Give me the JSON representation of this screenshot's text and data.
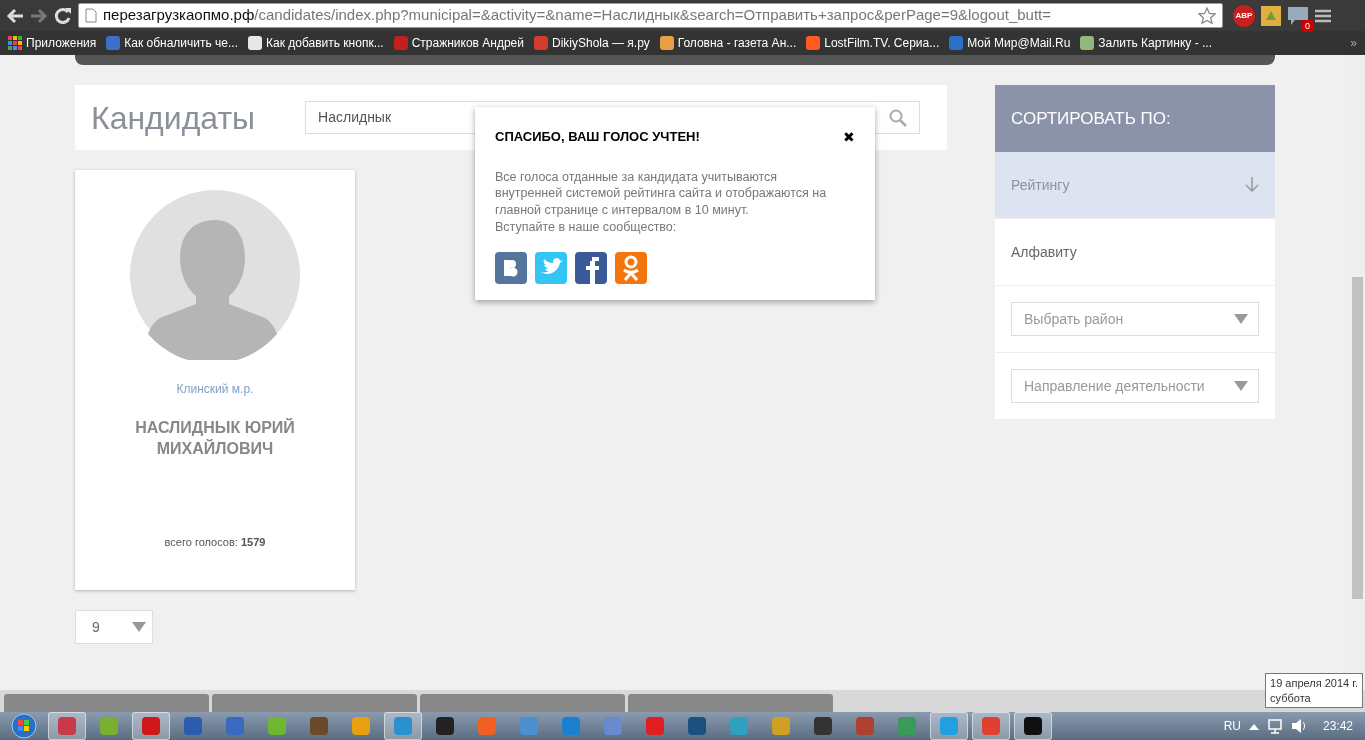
{
  "browser": {
    "url_host": "перезагрузкаопмо.рф",
    "url_rest": "/candidates/index.php?municipal=&activity=&name=Наслиднык&search=Отправить+запрос&perPage=9&logout_butt=",
    "abp": "ABP",
    "notify_count": "0",
    "apps_label": "Приложения",
    "bookmarks": [
      {
        "label": "Как обналичить че...",
        "color": "#3b6fc9"
      },
      {
        "label": "Как добавить кнопк...",
        "color": "#e8e8e8"
      },
      {
        "label": "Стражников Андрей",
        "color": "#c0201f"
      },
      {
        "label": "DikiyShola — я.ру",
        "color": "#d33b2c"
      },
      {
        "label": "Головна - газета Ан...",
        "color": "#e8a040"
      },
      {
        "label": "LostFilm.TV. Сериа...",
        "color": "#ff5a1f"
      },
      {
        "label": "Мой Мир@Mail.Ru",
        "color": "#2a6fc9"
      },
      {
        "label": "Залить Картинку - ...",
        "color": "#8fb87a"
      }
    ],
    "more": "»"
  },
  "page": {
    "title": "Кандидаты",
    "search": {
      "value": "Наслиднык"
    },
    "candidate": {
      "district": "Клинский м.р.",
      "name": "НАСЛИДНЫК ЮРИЙ МИХАЙЛОВИЧ",
      "votes_label": "всего голосов:",
      "votes": "1579"
    },
    "per_page": "9",
    "sort": {
      "title": "СОРТИРОВАТЬ ПО:",
      "options": [
        {
          "label": "Рейтингу",
          "selected": true
        },
        {
          "label": "Алфавиту",
          "selected": false
        }
      ],
      "dropdowns": [
        {
          "placeholder": "Выбрать район"
        },
        {
          "placeholder": "Направление деятельности"
        }
      ]
    }
  },
  "modal": {
    "title": "СПАСИБО, ВАШ ГОЛОС УЧТЕН!",
    "close": "✖",
    "text": "Все голоса отданные за кандидата учитываются внутренней системой рейтинга сайта и отображаются на главной странице с интервалом в 10 минут.",
    "invite": "Вступайте в наше сообщество:",
    "social": [
      {
        "kind": "vk"
      },
      {
        "kind": "twitter"
      },
      {
        "kind": "facebook"
      },
      {
        "kind": "ok"
      }
    ]
  },
  "taskbar": {
    "apps": [
      {
        "color": "#c83a4a",
        "active": true
      },
      {
        "color": "#7ab030",
        "active": false
      },
      {
        "color": "#d01818",
        "active": true
      },
      {
        "color": "#2a5cb0",
        "active": false
      },
      {
        "color": "#3a6ac0",
        "active": false
      },
      {
        "color": "#6cb830",
        "active": false
      },
      {
        "color": "#6a4a2a",
        "active": false
      },
      {
        "color": "#e8a010",
        "active": false
      },
      {
        "color": "#2a90d0",
        "active": true
      },
      {
        "color": "#222222",
        "active": false
      },
      {
        "color": "#f06020",
        "active": false
      },
      {
        "color": "#4a90d0",
        "active": false
      },
      {
        "color": "#1a80d0",
        "active": false
      },
      {
        "color": "#6a8ad0",
        "active": false
      },
      {
        "color": "#e02020",
        "active": false
      },
      {
        "color": "#1a5080",
        "active": false
      },
      {
        "color": "#30a0c0",
        "active": false
      },
      {
        "color": "#d0a020",
        "active": false
      },
      {
        "color": "#333333",
        "active": false
      },
      {
        "color": "#b04030",
        "active": false
      },
      {
        "color": "#3a9a5a",
        "active": false
      },
      {
        "color": "#20a0e0",
        "active": true
      },
      {
        "color": "#e04030",
        "active": true
      },
      {
        "color": "#101010",
        "active": true
      }
    ],
    "language": "RU",
    "clock": "23:42",
    "tooltip": [
      "19 апреля 2014 г.",
      "суббота"
    ]
  }
}
